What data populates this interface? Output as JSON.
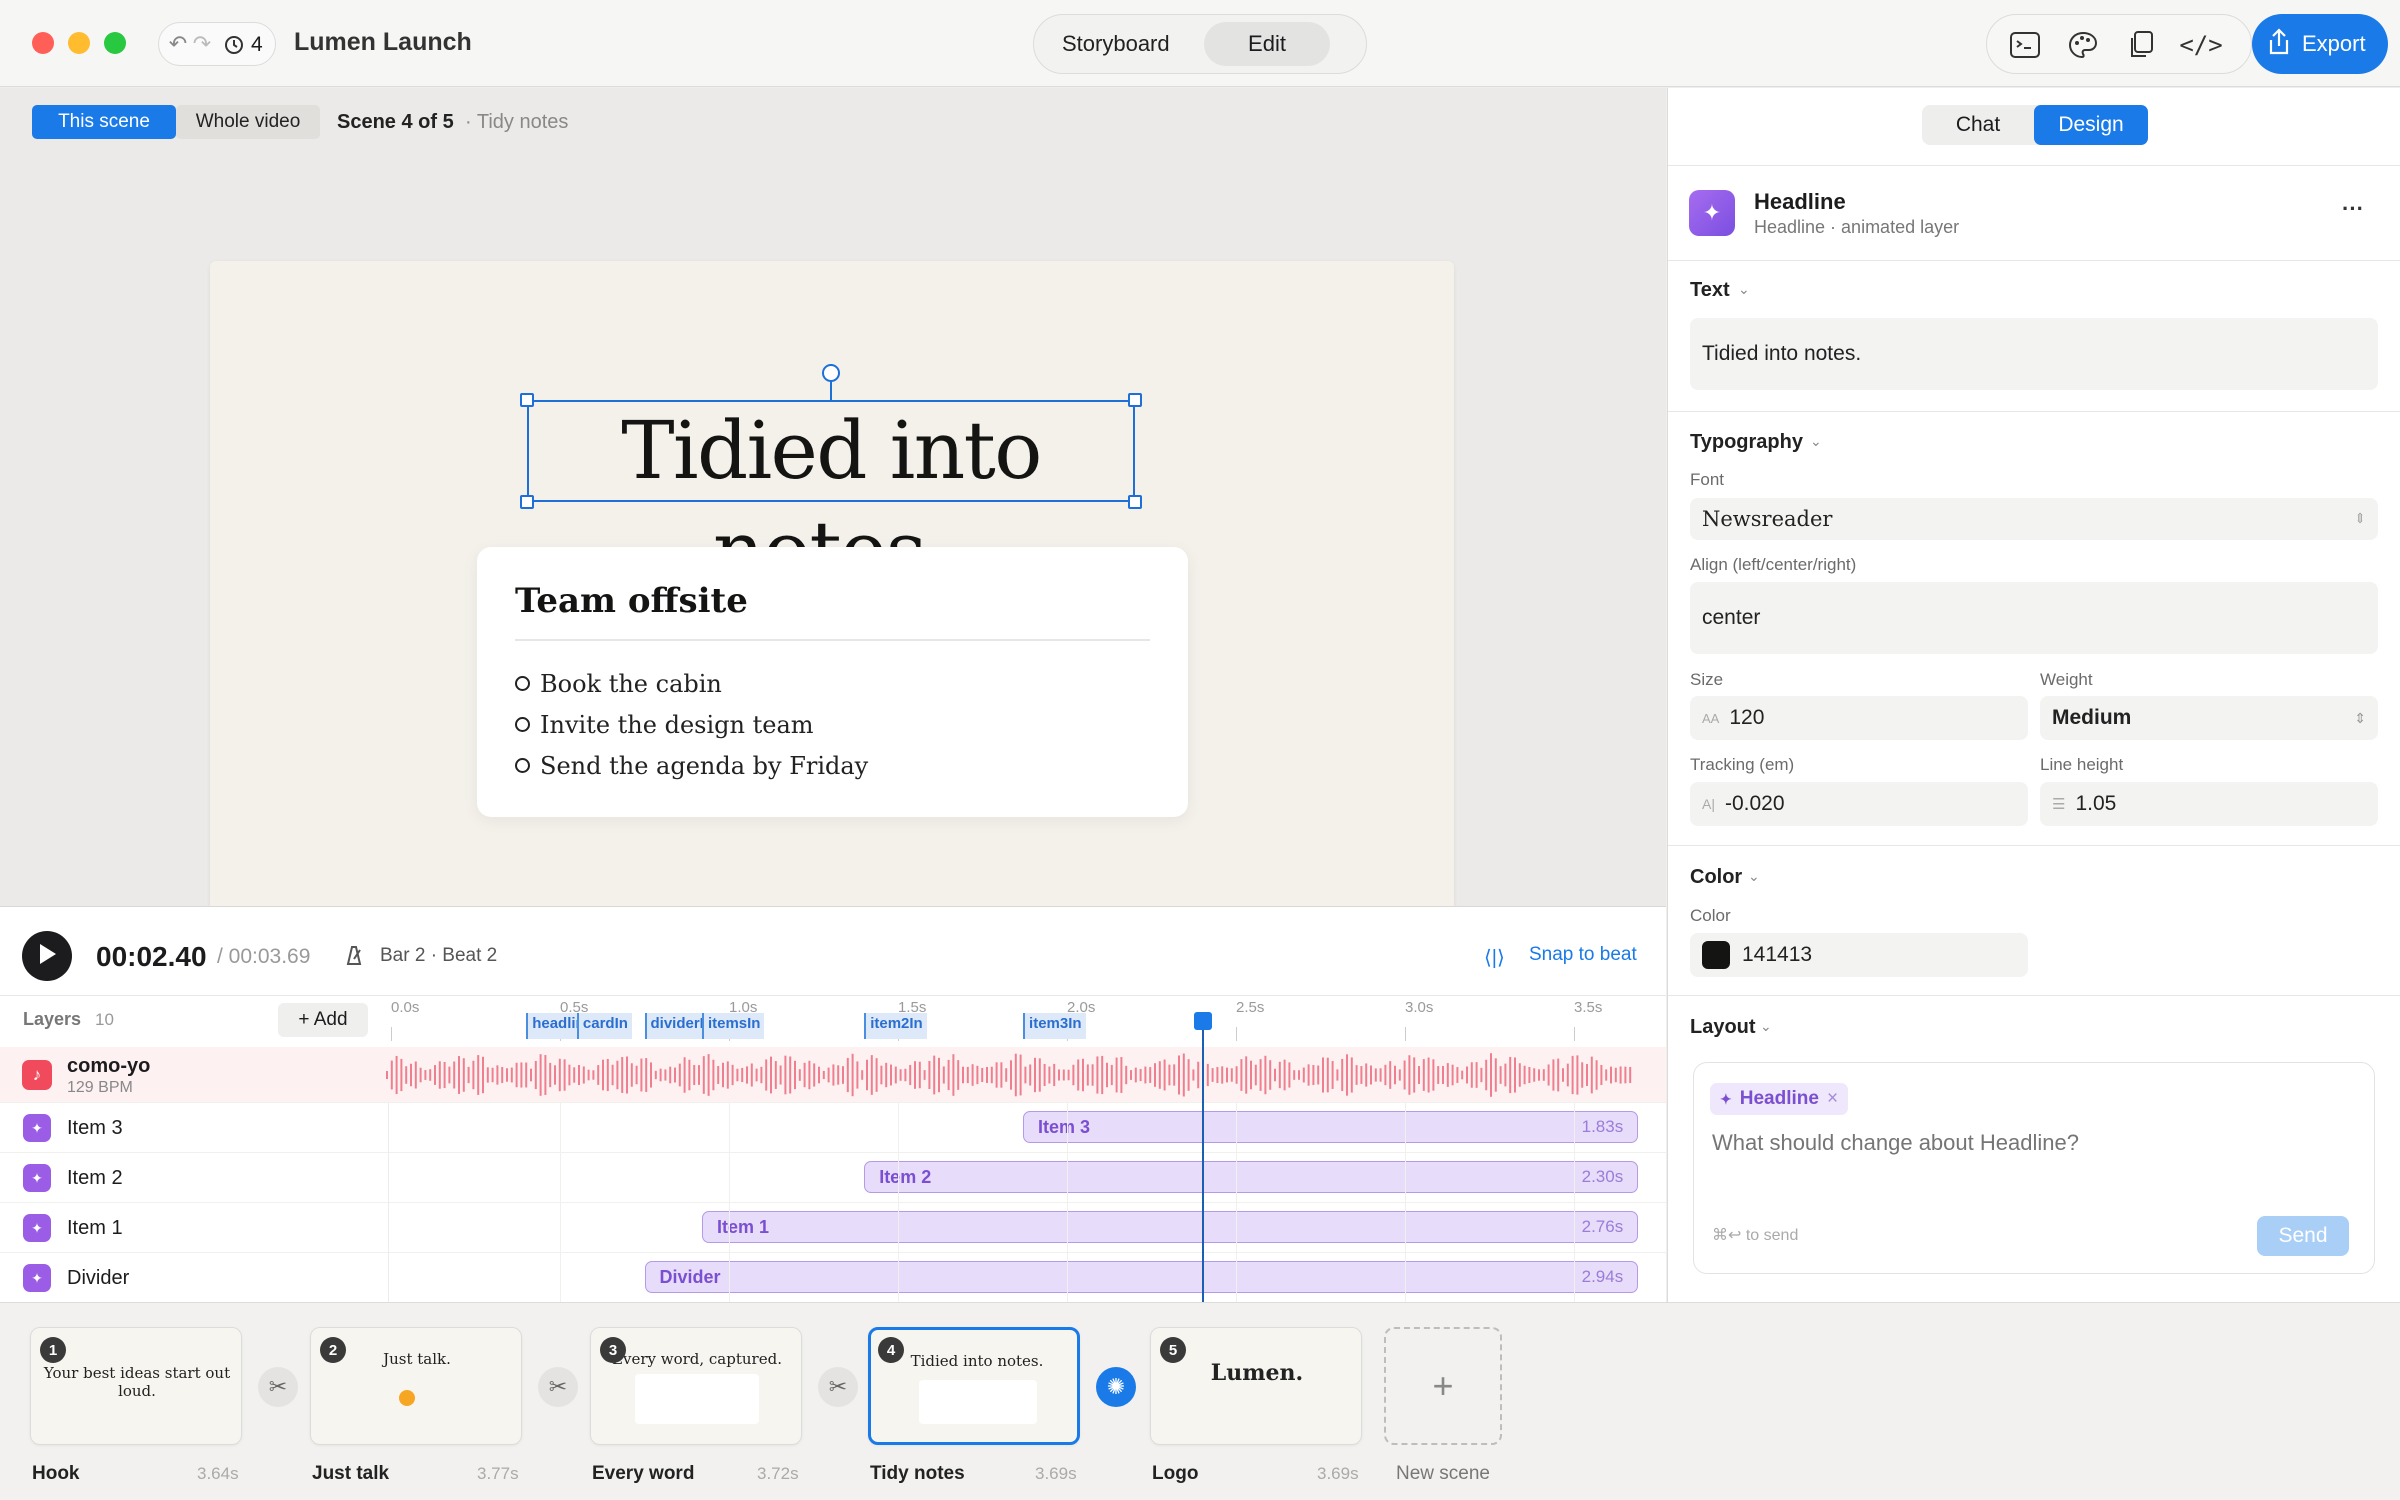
{
  "app": {
    "project_title": "Lumen Launch",
    "history_count": "4",
    "mode_tabs": [
      "Storyboard",
      "Edit"
    ],
    "active_mode": "Edit",
    "export_label": "Export"
  },
  "canvas": {
    "scope_tabs": [
      "This scene",
      "Whole video"
    ],
    "scene_label": "Scene 4 of 5",
    "scene_subtitle": "· Tidy notes",
    "headline": "Tidied into notes.",
    "card": {
      "title": "Team offsite",
      "items": [
        "Book the cabin",
        "Invite the design team",
        "Send the agenda by Friday"
      ]
    }
  },
  "playback": {
    "current_time": "00:02.40",
    "total_time": "/ 00:03.69",
    "bar_beat": "Bar 2 · Beat 2",
    "snap_label": "Snap to beat",
    "playhead_time_s": 2.4
  },
  "timeline": {
    "layers_label": "Layers",
    "layers_count": "10",
    "add_label": "+ Add",
    "ruler": [
      "0.0s",
      "0.5s",
      "1.0s",
      "1.5s",
      "2.0s",
      "2.5s",
      "3.0s",
      "3.5s"
    ],
    "markers": [
      {
        "label": "headlineIn",
        "t": 0.4
      },
      {
        "label": "cardIn",
        "t": 0.55
      },
      {
        "label": "dividerIn",
        "t": 0.75
      },
      {
        "label": "itemsIn",
        "t": 0.92
      },
      {
        "label": "item2In",
        "t": 1.4
      },
      {
        "label": "item3In",
        "t": 1.87
      }
    ],
    "audio": {
      "name": "como-yo",
      "bpm": "129 BPM"
    },
    "layers": [
      {
        "name": "Item 3",
        "clip": "Item 3",
        "start": 1.87,
        "duration": "1.83s"
      },
      {
        "name": "Item 2",
        "clip": "Item 2",
        "start": 1.4,
        "duration": "2.30s"
      },
      {
        "name": "Item 1",
        "clip": "Item 1",
        "start": 0.92,
        "duration": "2.76s"
      },
      {
        "name": "Divider",
        "clip": "Divider",
        "start": 0.75,
        "duration": "2.94s"
      }
    ]
  },
  "panel": {
    "tabs": [
      "Chat",
      "Design"
    ],
    "active_tab": "Design",
    "layer_name": "Headline",
    "layer_sub": "Headline · animated layer",
    "more": "···",
    "text_section": "Text",
    "text_value": "Tidied into notes.",
    "typography_section": "Typography",
    "font_label": "Font",
    "font_value": "Newsreader",
    "align_label": "Align (left/center/right)",
    "align_value": "center",
    "size_label": "Size",
    "size_value": "120",
    "weight_label": "Weight",
    "weight_value": "Medium",
    "tracking_label": "Tracking (em)",
    "tracking_value": "-0.020",
    "lineheight_label": "Line height",
    "lineheight_value": "1.05",
    "color_section": "Color",
    "color_label": "Color",
    "color_value": "141413",
    "color_hex": "#141413",
    "layout_section": "Layout",
    "chip": "Headline",
    "prompt_placeholder": "What should change about Headline?",
    "send_hint": "⌘↩ to send",
    "send_label": "Send"
  },
  "scenes": [
    {
      "num": "1",
      "name": "Hook",
      "dur": "3.64s",
      "thumb": "Your best ideas start out loud."
    },
    {
      "num": "2",
      "name": "Just talk",
      "dur": "3.77s",
      "thumb": "Just talk."
    },
    {
      "num": "3",
      "name": "Every word",
      "dur": "3.72s",
      "thumb": "Every word, captured."
    },
    {
      "num": "4",
      "name": "Tidy notes",
      "dur": "3.69s",
      "thumb": "Tidied into notes."
    },
    {
      "num": "5",
      "name": "Logo",
      "dur": "3.69s",
      "thumb": "Lumen."
    }
  ],
  "new_scene_label": "New scene"
}
